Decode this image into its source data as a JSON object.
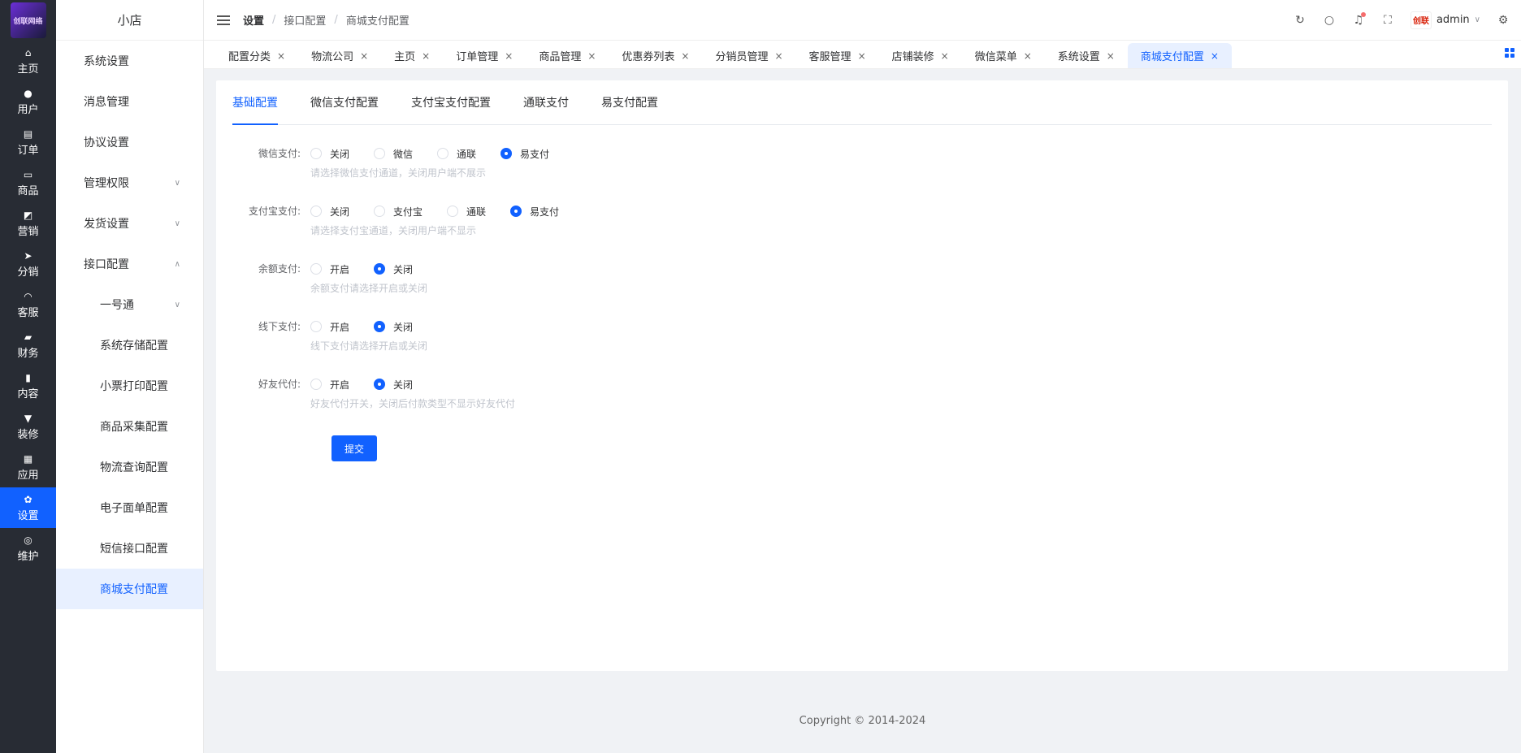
{
  "rail": {
    "logo_text": "创联网络",
    "items": [
      {
        "label": "主页",
        "icon": "⌂"
      },
      {
        "label": "用户",
        "icon": "●"
      },
      {
        "label": "订单",
        "icon": "▤"
      },
      {
        "label": "商品",
        "icon": "▭"
      },
      {
        "label": "营销",
        "icon": "◩"
      },
      {
        "label": "分销",
        "icon": "➤"
      },
      {
        "label": "客服",
        "icon": "◠"
      },
      {
        "label": "财务",
        "icon": "▰"
      },
      {
        "label": "内容",
        "icon": "▮"
      },
      {
        "label": "装修",
        "icon": "▼"
      },
      {
        "label": "应用",
        "icon": "▦"
      },
      {
        "label": "设置",
        "icon": "✿"
      },
      {
        "label": "维护",
        "icon": "◎"
      }
    ]
  },
  "submenu": {
    "title": "小店",
    "items": [
      {
        "label": "系统设置"
      },
      {
        "label": "消息管理"
      },
      {
        "label": "协议设置"
      },
      {
        "label": "管理权限",
        "chev": "∨"
      },
      {
        "label": "发货设置",
        "chev": "∨"
      },
      {
        "label": "接口配置",
        "chev": "∧"
      },
      {
        "label": "一号通",
        "chev": "∨"
      },
      {
        "label": "系统存储配置"
      },
      {
        "label": "小票打印配置"
      },
      {
        "label": "商品采集配置"
      },
      {
        "label": "物流查询配置"
      },
      {
        "label": "电子面单配置"
      },
      {
        "label": "短信接口配置"
      },
      {
        "label": "商城支付配置"
      }
    ]
  },
  "header": {
    "breadcrumb": [
      "设置",
      "接口配置",
      "商城支付配置"
    ],
    "breadcrumb_sep": "/",
    "user_name": "admin",
    "avatar_text": "创联",
    "icons": {
      "refresh": "↻",
      "search": "○",
      "bell": "♫",
      "fullscreen": "⛶",
      "settings": "⚙",
      "chevron": "∨"
    }
  },
  "tabs": [
    {
      "label": "配置分类"
    },
    {
      "label": "物流公司"
    },
    {
      "label": "主页"
    },
    {
      "label": "订单管理"
    },
    {
      "label": "商品管理"
    },
    {
      "label": "优惠券列表"
    },
    {
      "label": "分销员管理"
    },
    {
      "label": "客服管理"
    },
    {
      "label": "店铺装修"
    },
    {
      "label": "微信菜单"
    },
    {
      "label": "系统设置"
    },
    {
      "label": "商城支付配置"
    }
  ],
  "tab_close": "×",
  "page_tabs": [
    "基础配置",
    "微信支付配置",
    "支付宝支付配置",
    "通联支付",
    "易支付配置"
  ],
  "form": {
    "rows": [
      {
        "label": "微信支付:",
        "options": [
          "关闭",
          "微信",
          "通联",
          "易支付"
        ],
        "selected": "易支付",
        "hint": "请选择微信支付通道，关闭用户端不展示"
      },
      {
        "label": "支付宝支付:",
        "options": [
          "关闭",
          "支付宝",
          "通联",
          "易支付"
        ],
        "selected": "易支付",
        "hint": "请选择支付宝通道，关闭用户端不显示"
      },
      {
        "label": "余额支付:",
        "options": [
          "开启",
          "关闭"
        ],
        "selected": "关闭",
        "hint": "余额支付请选择开启或关闭"
      },
      {
        "label": "线下支付:",
        "options": [
          "开启",
          "关闭"
        ],
        "selected": "关闭",
        "hint": "线下支付请选择开启或关闭"
      },
      {
        "label": "好友代付:",
        "options": [
          "开启",
          "关闭"
        ],
        "selected": "关闭",
        "hint": "好友代付开关，关闭后付款类型不显示好友代付"
      }
    ],
    "submit_label": "提交"
  },
  "footer": {
    "copyright": "Copyright © 2014-2024"
  },
  "colors": {
    "accent": "#1161ff",
    "rail_bg": "#282c34"
  }
}
